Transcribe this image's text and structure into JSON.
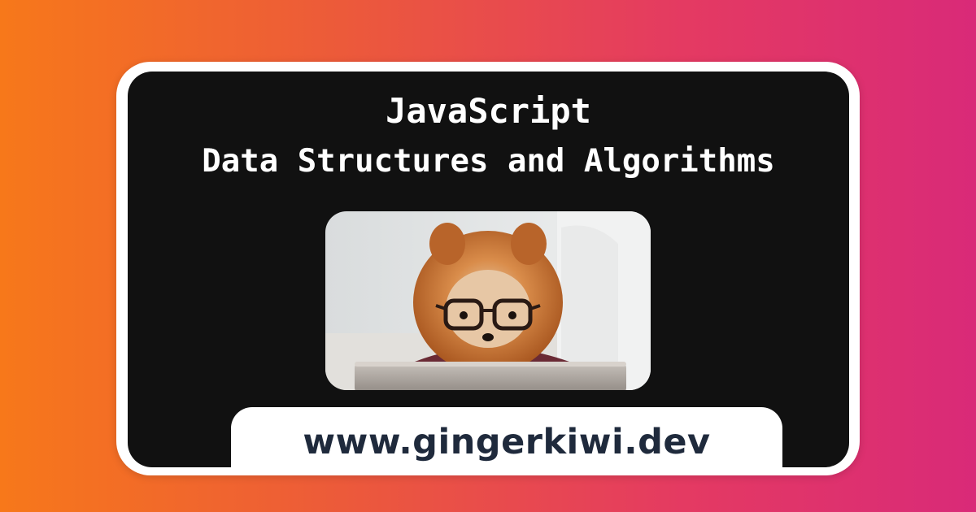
{
  "title": {
    "line1": "JavaScript",
    "line2": "Data Structures and Algorithms"
  },
  "photo": {
    "subject": "pomeranian-dog-with-glasses-and-tablet"
  },
  "site": {
    "url": "www.gingerkiwi.dev"
  },
  "colors": {
    "gradient_start": "#f7781a",
    "gradient_end": "#d92a78",
    "card_border": "#ffffff",
    "card_background": "#111111",
    "title_text": "#ffffff",
    "url_text": "#1f2a3c"
  }
}
